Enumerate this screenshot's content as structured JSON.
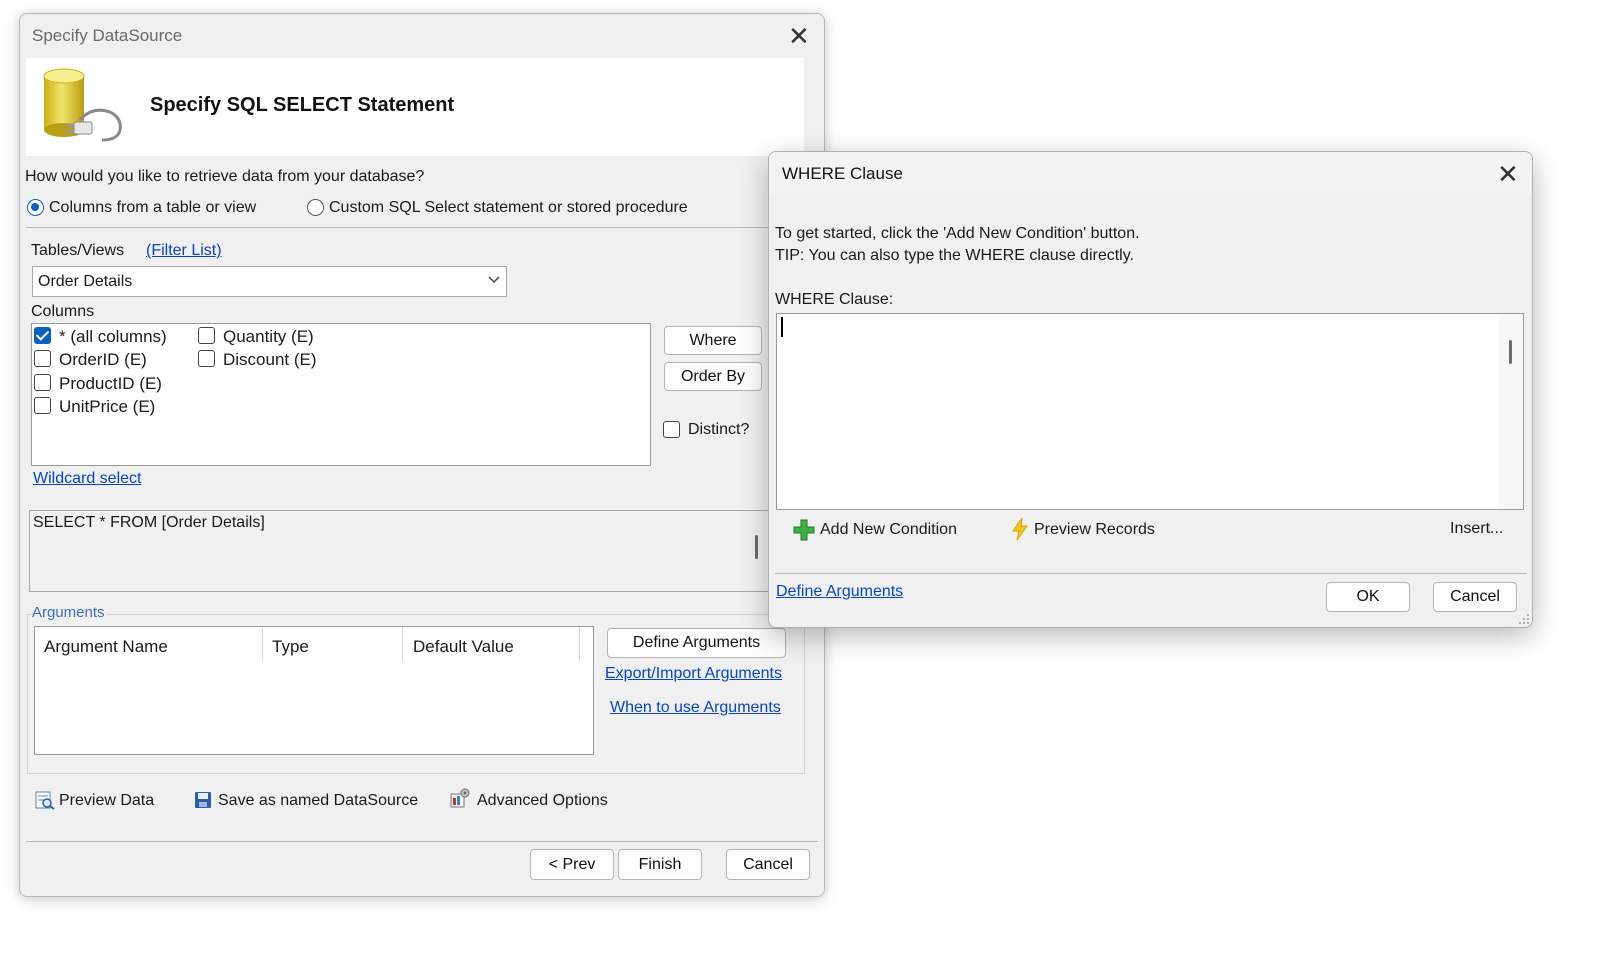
{
  "main_dialog": {
    "title": "Specify DataSource",
    "header_title": "Specify SQL SELECT Statement",
    "question": "How would you like to retrieve data from your database?",
    "radio_columns": "Columns from a table or view",
    "radio_custom": "Custom SQL Select statement or stored procedure",
    "radio_selected": "columns",
    "tables_label": "Tables/Views",
    "filter_list": "(Filter List)",
    "table_selected": "Order Details",
    "columns_label": "Columns",
    "columns": [
      {
        "label": "* (all columns)",
        "checked": true
      },
      {
        "label": "OrderID (E)",
        "checked": false
      },
      {
        "label": "ProductID (E)",
        "checked": false
      },
      {
        "label": "UnitPrice (E)",
        "checked": false
      },
      {
        "label": "Quantity (E)",
        "checked": false
      },
      {
        "label": "Discount (E)",
        "checked": false
      }
    ],
    "where_button": "Where",
    "orderby_button": "Order By",
    "distinct_label": "Distinct?",
    "wildcard_link": "Wildcard select",
    "sql_text": "SELECT * FROM [Order Details]",
    "arguments_label": "Arguments",
    "arg_columns": [
      "Argument Name",
      "Type",
      "Default Value"
    ],
    "define_arguments_button": "Define Arguments",
    "export_import_link": "Export/Import Arguments",
    "when_to_use_link": "When to use Arguments",
    "preview_data": "Preview Data",
    "save_named": "Save as named DataSource",
    "advanced_options": "Advanced Options",
    "prev_button": "< Prev",
    "finish_button": "Finish",
    "cancel_button": "Cancel"
  },
  "where_dialog": {
    "title": "WHERE Clause",
    "info_line1": "To get started, click the 'Add New Condition' button.",
    "info_line2": "TIP: You can also type the WHERE clause directly.",
    "where_label": "WHERE Clause:",
    "where_value": "",
    "add_condition": "Add New Condition",
    "preview_records": "Preview Records",
    "insert": "Insert...",
    "define_arguments_link": "Define Arguments",
    "ok_button": "OK",
    "cancel_button": "Cancel"
  },
  "colors": {
    "accent": "#0a5fc2",
    "link": "#0645c8",
    "group_label": "#3a6fbf"
  }
}
